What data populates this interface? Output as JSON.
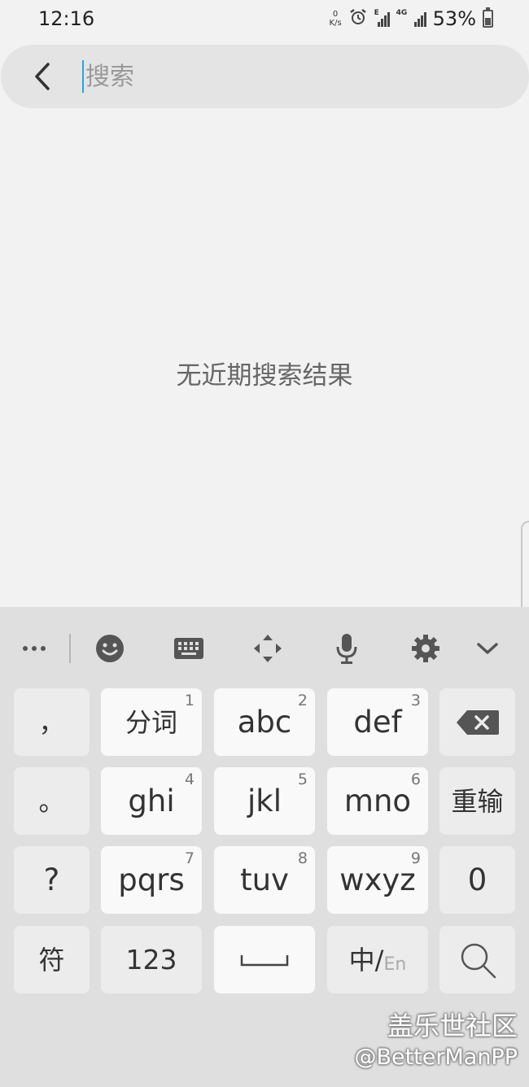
{
  "status_bar": {
    "time": "12:16",
    "net_speed_value": "0",
    "net_speed_unit": "K/s",
    "signal1_tag": "E",
    "signal2_tag": "4G",
    "battery_percent": "53%",
    "icons": [
      "alarm-icon",
      "signal-icon",
      "battery-icon"
    ]
  },
  "search": {
    "placeholder": "搜索",
    "value": ""
  },
  "main": {
    "empty_message": "无近期搜索结果"
  },
  "keyboard": {
    "toolbar": [
      "more-icon",
      "emoji-icon",
      "keyboard-icon",
      "cursor-move-icon",
      "mic-icon",
      "settings-icon",
      "collapse-icon"
    ],
    "rows": [
      [
        {
          "label": "，",
          "digit": ""
        },
        {
          "label": "分词",
          "digit": "1"
        },
        {
          "label": "abc",
          "digit": "2"
        },
        {
          "label": "def",
          "digit": "3"
        },
        {
          "label": "",
          "digit": ""
        }
      ],
      [
        {
          "label": "。",
          "digit": ""
        },
        {
          "label": "ghi",
          "digit": "4"
        },
        {
          "label": "jkl",
          "digit": "5"
        },
        {
          "label": "mno",
          "digit": "6"
        },
        {
          "label": "重输",
          "digit": ""
        }
      ],
      [
        {
          "label": "?",
          "digit": ""
        },
        {
          "label": "pqrs",
          "digit": "7"
        },
        {
          "label": "tuv",
          "digit": "8"
        },
        {
          "label": "wxyz",
          "digit": "9"
        },
        {
          "label": "0",
          "digit": ""
        }
      ],
      [
        {
          "label": "符",
          "digit": ""
        },
        {
          "label": "123",
          "digit": ""
        },
        {
          "label": "",
          "digit": ""
        },
        {
          "label_main": "中/",
          "label_sub": "En"
        },
        {
          "label": "",
          "digit": ""
        }
      ]
    ]
  },
  "watermark": {
    "line1": "盖乐世社区",
    "line2": "@BetterManPP"
  },
  "colors": {
    "background": "#f2f2f2",
    "keyboard_bg": "#dfdfdf",
    "cursor": "#2aa3d8"
  }
}
